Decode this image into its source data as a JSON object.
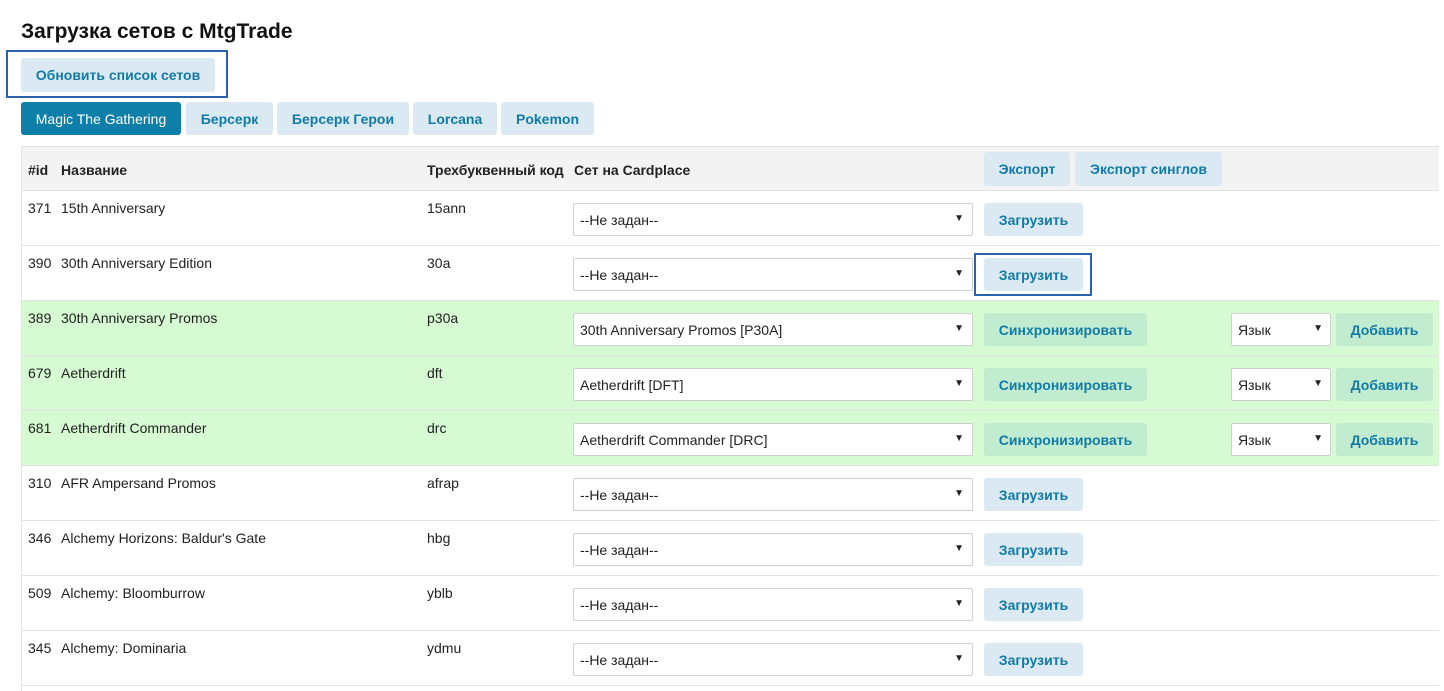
{
  "page": {
    "title": "Загрузка сетов с MtgTrade"
  },
  "refresh_button": "Обновить список сетов",
  "tabs": [
    {
      "label": "Magic The Gathering",
      "active": true
    },
    {
      "label": "Берсерк",
      "active": false
    },
    {
      "label": "Берсерк Герои",
      "active": false
    },
    {
      "label": "Lorcana",
      "active": false
    },
    {
      "label": "Pokemon",
      "active": false
    }
  ],
  "table": {
    "headers": {
      "id": "#id",
      "name": "Название",
      "code": "Трехбуквенный код",
      "cardplace": "Сет на Cardplace"
    },
    "export_button": "Экспорт",
    "export_singles_button": "Экспорт синглов",
    "rows": [
      {
        "id": "371",
        "name": "15th Anniversary",
        "code": "15ann",
        "set": "--Не задан--",
        "action": "Загрузить",
        "synced": false
      },
      {
        "id": "390",
        "name": "30th Anniversary Edition",
        "code": "30a",
        "set": "--Не задан--",
        "action": "Загрузить",
        "synced": false
      },
      {
        "id": "389",
        "name": "30th Anniversary Promos",
        "code": "p30a",
        "set": "30th Anniversary Promos [P30A]",
        "action": "Синхронизировать",
        "lang": "Язык",
        "add": "Добавить",
        "synced": true
      },
      {
        "id": "679",
        "name": "Aetherdrift",
        "code": "dft",
        "set": "Aetherdrift [DFT]",
        "action": "Синхронизировать",
        "lang": "Язык",
        "add": "Добавить",
        "synced": true
      },
      {
        "id": "681",
        "name": "Aetherdrift Commander",
        "code": "drc",
        "set": "Aetherdrift Commander [DRC]",
        "action": "Синхронизировать",
        "lang": "Язык",
        "add": "Добавить",
        "synced": true
      },
      {
        "id": "310",
        "name": "AFR Ampersand Promos",
        "code": "afrap",
        "set": "--Не задан--",
        "action": "Загрузить",
        "synced": false
      },
      {
        "id": "346",
        "name": "Alchemy Horizons: Baldur's Gate",
        "code": "hbg",
        "set": "--Не задан--",
        "action": "Загрузить",
        "synced": false
      },
      {
        "id": "509",
        "name": "Alchemy: Bloomburrow",
        "code": "yblb",
        "set": "--Не задан--",
        "action": "Загрузить",
        "synced": false
      },
      {
        "id": "345",
        "name": "Alchemy: Dominaria",
        "code": "ydmu",
        "set": "--Не задан--",
        "action": "Загрузить",
        "synced": false
      }
    ]
  },
  "colors": {
    "accent": "#0e7fa8",
    "button_bg": "#dbeaf2",
    "synced_row": "#d6fad1",
    "highlight": "#2a62ab"
  }
}
